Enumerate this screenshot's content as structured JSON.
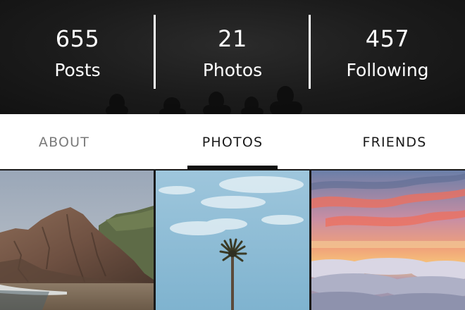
{
  "stats": [
    {
      "value": "655",
      "label": "Posts"
    },
    {
      "value": "21",
      "label": "Photos"
    },
    {
      "value": "457",
      "label": "Following"
    }
  ],
  "tabs": [
    {
      "label": "ABOUT",
      "state": "inactive"
    },
    {
      "label": "PHOTOS",
      "state": "active"
    },
    {
      "label": "FRIENDS",
      "state": "inactive"
    }
  ],
  "photos": [
    {
      "subject": "coastal-cliff"
    },
    {
      "subject": "palm-tree-sky"
    },
    {
      "subject": "sunset-over-clouds"
    }
  ],
  "colors": {
    "header_bg": "#1b1b1b",
    "header_text": "#ffffff",
    "tab_active": "#1a1a1a",
    "tab_inactive": "#7a7a7a",
    "indicator": "#111111"
  }
}
